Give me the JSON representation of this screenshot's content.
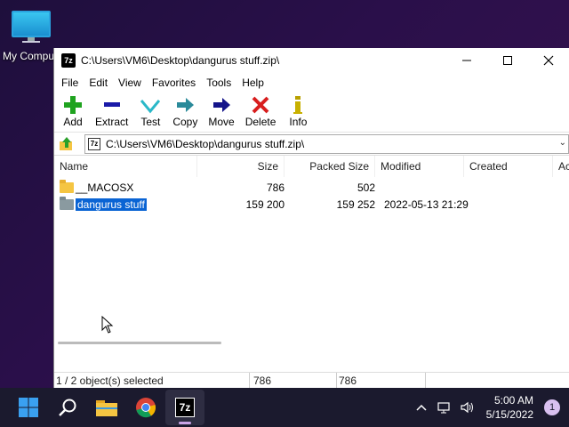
{
  "desktop": {
    "icon_label": "My Compu"
  },
  "window": {
    "title": "C:\\Users\\VM6\\Desktop\\dangurus stuff.zip\\",
    "app_icon_text": "7z",
    "controls": {
      "minimize": "—",
      "maximize": "☐",
      "close": "✕"
    }
  },
  "menu": [
    "File",
    "Edit",
    "View",
    "Favorites",
    "Tools",
    "Help"
  ],
  "toolbar": {
    "add": "Add",
    "extract": "Extract",
    "test": "Test",
    "copy": "Copy",
    "move": "Move",
    "delete": "Delete",
    "info": "Info"
  },
  "address": {
    "path": "C:\\Users\\VM6\\Desktop\\dangurus stuff.zip\\"
  },
  "columns": {
    "name": "Name",
    "size": "Size",
    "packed": "Packed Size",
    "modified": "Modified",
    "created": "Created",
    "accessed": "Ac"
  },
  "files": [
    {
      "name": "__MACOSX",
      "size": "786",
      "packed": "502",
      "modified": ""
    },
    {
      "name": "dangurus stuff",
      "size": "159 200",
      "packed": "159 252",
      "modified": "2022-05-13 21:29"
    }
  ],
  "status": {
    "selection": "1 / 2 object(s) selected",
    "size": "786",
    "packed": "786"
  },
  "taskbar": {
    "time": "5:00 AM",
    "date": "5/15/2022",
    "notifications": "1",
    "active_app_text": "7z"
  },
  "colors": {
    "selection": "#0a64d4",
    "taskbar": "#1b1a2e",
    "folder": "#f5c542"
  }
}
